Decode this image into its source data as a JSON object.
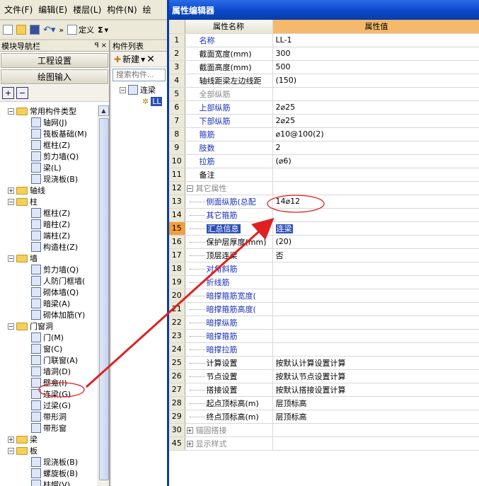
{
  "menu": [
    "文件(F)",
    "编辑(E)",
    "楼层(L)",
    "构件(N)",
    "绘"
  ],
  "toolbar": {
    "define_label": "定义",
    "sigma_label": "Σ"
  },
  "nav": {
    "title": "模块导航栏",
    "pin": "ꟼ",
    "close": "×",
    "engineering_btn": "工程设置",
    "drawing_btn": "绘图输入",
    "tree": [
      {
        "level": 0,
        "exp": "−",
        "type": "folder",
        "label": "常用构件类型"
      },
      {
        "level": 1,
        "type": "comp",
        "label": "轴网(J)"
      },
      {
        "level": 1,
        "type": "comp",
        "label": "筏板基础(M)"
      },
      {
        "level": 1,
        "type": "comp",
        "label": "框柱(Z)"
      },
      {
        "level": 1,
        "type": "comp",
        "label": "剪力墙(Q)"
      },
      {
        "level": 1,
        "type": "comp",
        "label": "梁(L)"
      },
      {
        "level": 1,
        "type": "comp",
        "label": "现浇板(B)"
      },
      {
        "level": 0,
        "exp": "+",
        "type": "folder",
        "label": "轴线"
      },
      {
        "level": 0,
        "exp": "−",
        "type": "folder",
        "label": "柱"
      },
      {
        "level": 1,
        "type": "comp",
        "label": "框柱(Z)"
      },
      {
        "level": 1,
        "type": "comp",
        "label": "暗柱(Z)"
      },
      {
        "level": 1,
        "type": "comp",
        "label": "端柱(Z)"
      },
      {
        "level": 1,
        "type": "comp",
        "label": "构造柱(Z)"
      },
      {
        "level": 0,
        "exp": "−",
        "type": "folder",
        "label": "墙"
      },
      {
        "level": 1,
        "type": "comp",
        "label": "剪力墙(Q)"
      },
      {
        "level": 1,
        "type": "comp",
        "label": "人防门框墙("
      },
      {
        "level": 1,
        "type": "comp",
        "label": "砌体墙(Q)"
      },
      {
        "level": 1,
        "type": "comp",
        "label": "暗梁(A)"
      },
      {
        "level": 1,
        "type": "comp",
        "label": "砌体加筋(Y)"
      },
      {
        "level": 0,
        "exp": "−",
        "type": "folder",
        "label": "门窗洞"
      },
      {
        "level": 1,
        "type": "comp",
        "label": "门(M)"
      },
      {
        "level": 1,
        "type": "comp",
        "label": "窗(C)"
      },
      {
        "level": 1,
        "type": "comp",
        "label": "门联窗(A)"
      },
      {
        "level": 1,
        "type": "comp",
        "label": "墙洞(D)"
      },
      {
        "level": 1,
        "type": "comp",
        "label": "壁龛(I)"
      },
      {
        "level": 1,
        "type": "comp",
        "label": "连梁(G)",
        "circled": true
      },
      {
        "level": 1,
        "type": "comp",
        "label": "过梁(G)"
      },
      {
        "level": 1,
        "type": "comp",
        "label": "带形洞"
      },
      {
        "level": 1,
        "type": "comp",
        "label": "带形窗"
      },
      {
        "level": 0,
        "exp": "+",
        "type": "folder",
        "label": "梁"
      },
      {
        "level": 0,
        "exp": "−",
        "type": "folder",
        "label": "板"
      },
      {
        "level": 1,
        "type": "comp",
        "label": "现浇板(B)"
      },
      {
        "level": 1,
        "type": "comp",
        "label": "螺旋板(B)"
      },
      {
        "level": 1,
        "type": "comp",
        "label": "柱帽(V)"
      }
    ]
  },
  "complist": {
    "title": "构件列表",
    "new_label": "新建",
    "search_placeholder": "搜索构件...",
    "items": [
      {
        "exp": "−",
        "label": "连梁"
      },
      {
        "label": "LL"
      }
    ]
  },
  "editor": {
    "title": "属性编辑器",
    "col_name": "属性名称",
    "col_value": "属性值",
    "rows": [
      {
        "n": "1",
        "name": "名称",
        "value": "LL-1",
        "style": "blue"
      },
      {
        "n": "2",
        "name": "截面宽度(mm)",
        "value": "300",
        "style": ""
      },
      {
        "n": "3",
        "name": "截面高度(mm)",
        "value": "500",
        "style": ""
      },
      {
        "n": "4",
        "name": "轴线距梁左边线距",
        "value": "(150)",
        "style": ""
      },
      {
        "n": "5",
        "name": "全部纵筋",
        "value": "",
        "style": "gray"
      },
      {
        "n": "6",
        "name": "上部纵筋",
        "value": "2⌀25",
        "style": "blue"
      },
      {
        "n": "7",
        "name": "下部纵筋",
        "value": "2⌀25",
        "style": "blue"
      },
      {
        "n": "8",
        "name": "箍筋",
        "value": "⌀10@100(2)",
        "style": "blue"
      },
      {
        "n": "9",
        "name": "肢数",
        "value": "2",
        "style": "blue"
      },
      {
        "n": "10",
        "name": "拉筋",
        "value": "(⌀6)",
        "style": "blue"
      },
      {
        "n": "11",
        "name": "备注",
        "value": "",
        "style": ""
      },
      {
        "n": "12",
        "name": "其它属性",
        "value": "",
        "style": "gray",
        "group": "−"
      },
      {
        "n": "13",
        "name": "侧面纵筋(总配",
        "value": "14⌀12",
        "style": "blue",
        "sub": true,
        "circled": true
      },
      {
        "n": "14",
        "name": "其它箍筋",
        "value": "",
        "style": "blue",
        "sub": true
      },
      {
        "n": "15",
        "name": "汇总信息",
        "value": "连梁",
        "style": "selected",
        "sub": true
      },
      {
        "n": "16",
        "name": "保护层厚度(mm)",
        "value": "(20)",
        "style": "",
        "sub": true
      },
      {
        "n": "17",
        "name": "顶层连梁",
        "value": "否",
        "style": "",
        "sub": true
      },
      {
        "n": "18",
        "name": "对角斜筋",
        "value": "",
        "style": "blue",
        "sub": true
      },
      {
        "n": "19",
        "name": "折线筋",
        "value": "",
        "style": "blue",
        "sub": true
      },
      {
        "n": "20",
        "name": "暗撑箍筋宽度(",
        "value": "",
        "style": "blue",
        "sub": true
      },
      {
        "n": "21",
        "name": "暗撑箍筋高度(",
        "value": "",
        "style": "blue",
        "sub": true
      },
      {
        "n": "22",
        "name": "暗撑纵筋",
        "value": "",
        "style": "blue",
        "sub": true
      },
      {
        "n": "23",
        "name": "暗撑箍筋",
        "value": "",
        "style": "blue",
        "sub": true
      },
      {
        "n": "24",
        "name": "暗撑拉筋",
        "value": "",
        "style": "blue",
        "sub": true
      },
      {
        "n": "25",
        "name": "计算设置",
        "value": "按默认计算设置计算",
        "style": "",
        "sub": true
      },
      {
        "n": "26",
        "name": "节点设置",
        "value": "按默认节点设置计算",
        "style": "",
        "sub": true
      },
      {
        "n": "27",
        "name": "搭接设置",
        "value": "按默认搭接设置计算",
        "style": "",
        "sub": true
      },
      {
        "n": "28",
        "name": "起点顶标高(m)",
        "value": "层顶标高",
        "style": "",
        "sub": true
      },
      {
        "n": "29",
        "name": "终点顶标高(m)",
        "value": "层顶标高",
        "style": "",
        "sub": true
      },
      {
        "n": "30",
        "name": "锚固搭接",
        "value": "",
        "style": "gray",
        "group": "+"
      },
      {
        "n": "45",
        "name": "显示样式",
        "value": "",
        "style": "gray",
        "group": "+"
      }
    ]
  },
  "colors": {
    "accent_blue": "#1a2fb8",
    "selection": "#2b4fb8",
    "highlight_orange": "#f2a03c",
    "annotation_red": "#e02020"
  }
}
